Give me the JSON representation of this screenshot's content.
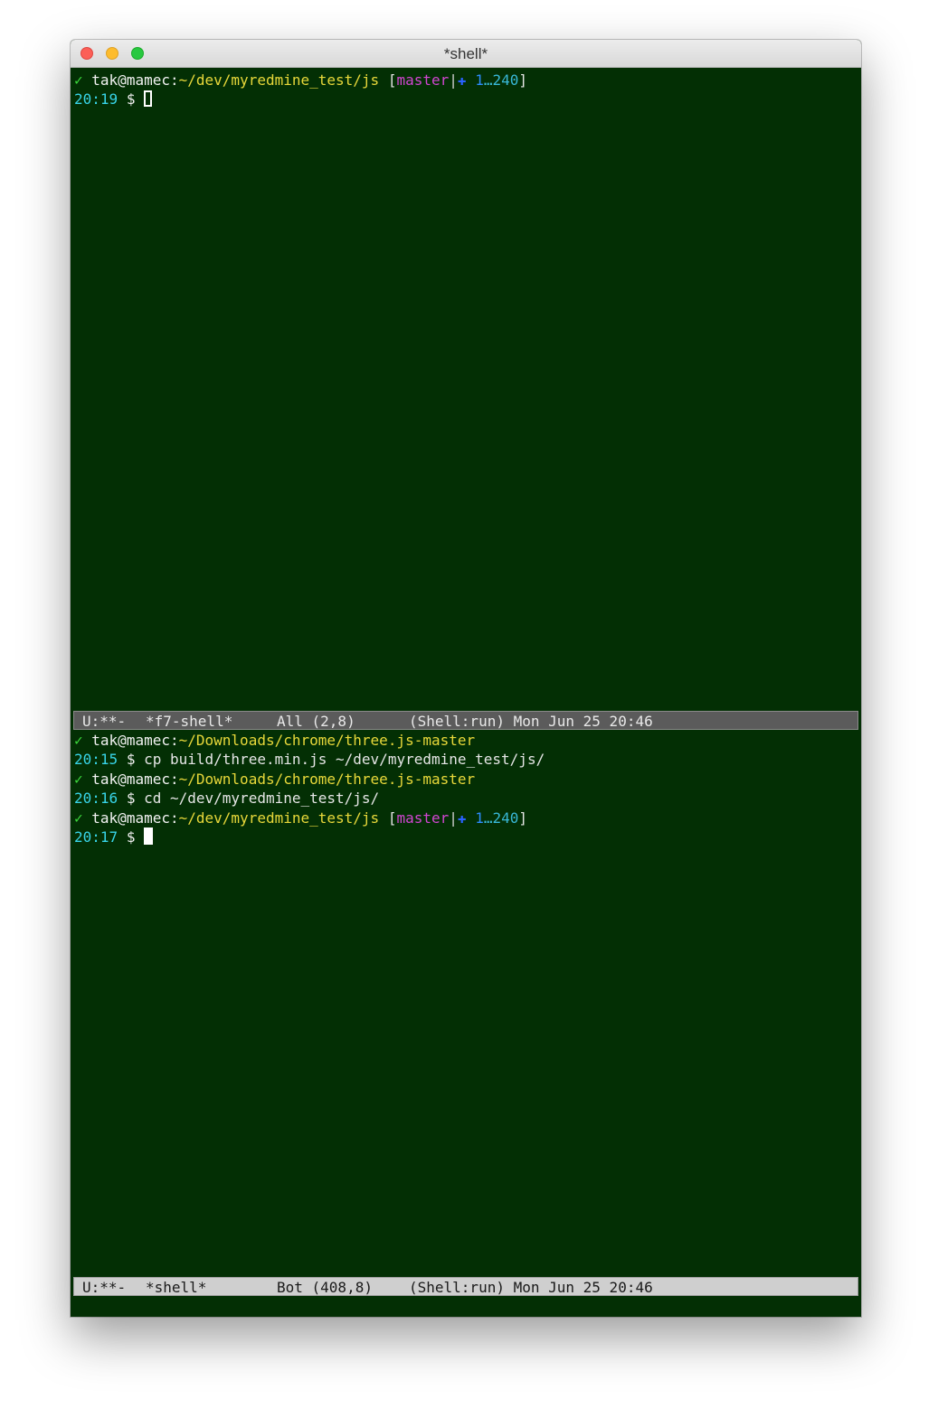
{
  "window": {
    "title": "*shell*",
    "buttons": {
      "close": "close-button",
      "minimize": "minimize-button",
      "zoom": "zoom-button"
    }
  },
  "top_pane": {
    "prompt": {
      "check": "✓",
      "user_host": "tak@mamec",
      "colon": ":",
      "path": "~/dev/myredmine_test/js",
      "bracket_open": "[",
      "branch": "master",
      "separator": "|",
      "staged": "✚",
      "staged_count": "1",
      "ellipsis": "…",
      "untracked_count": "240",
      "bracket_close": "]"
    },
    "input_line": {
      "time": "20:19",
      "dollar": "$"
    }
  },
  "top_modeline": {
    "state": "U:**-",
    "buffer": "*f7-shell*",
    "position": "All (2,8)",
    "mode": "(Shell:run) Mon Jun 25 20:46"
  },
  "bottom_pane": {
    "history": [
      {
        "check": "✓",
        "user_host": "tak@mamec",
        "colon": ":",
        "path": "~/Downloads/chrome/three.js-master",
        "time": "20:15",
        "dollar": "$",
        "command": "cp build/three.min.js ~/dev/myredmine_test/js/"
      },
      {
        "check": "✓",
        "user_host": "tak@mamec",
        "colon": ":",
        "path": "~/Downloads/chrome/three.js-master",
        "time": "20:16",
        "dollar": "$",
        "command": "cd ~/dev/myredmine_test/js/"
      }
    ],
    "prompt": {
      "check": "✓",
      "user_host": "tak@mamec",
      "colon": ":",
      "path": "~/dev/myredmine_test/js",
      "bracket_open": "[",
      "branch": "master",
      "separator": "|",
      "staged": "✚",
      "staged_count": "1",
      "ellipsis": "…",
      "untracked_count": "240",
      "bracket_close": "]"
    },
    "input_line": {
      "time": "20:17",
      "dollar": "$"
    }
  },
  "bottom_modeline": {
    "state": "U:**-",
    "buffer": "*shell*",
    "position": "Bot (408,8)",
    "mode": "(Shell:run) Mon Jun 25 20:46"
  }
}
